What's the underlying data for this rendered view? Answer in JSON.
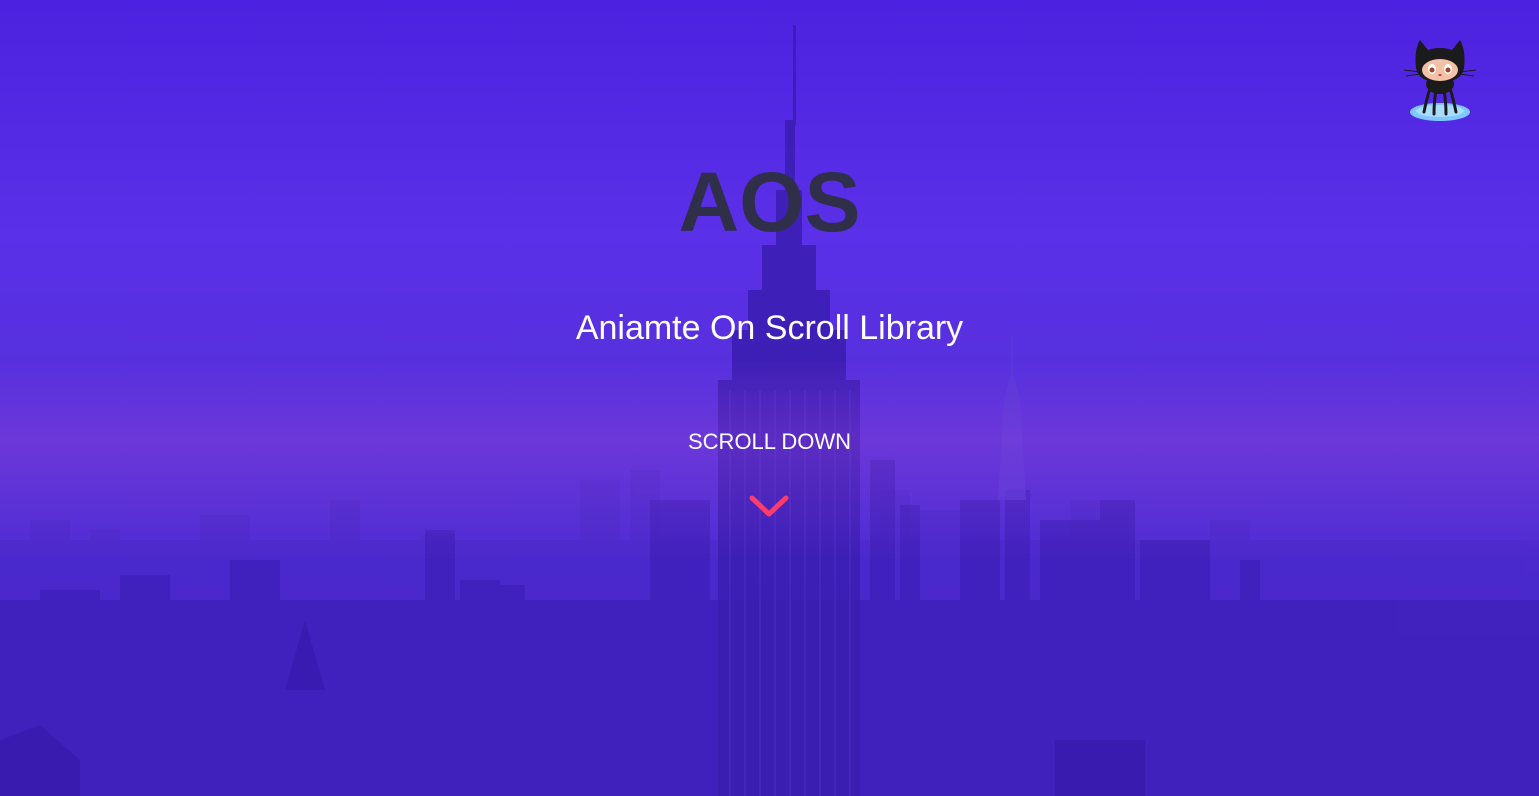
{
  "hero": {
    "title": "AOS",
    "subtitle": "Aniamte On Scroll Library",
    "scroll_label": "SCROLL DOWN"
  },
  "icons": {
    "github": "octocat-icon",
    "scroll": "chevron-down-icon"
  },
  "colors": {
    "background": "#5530d8",
    "title": "#2f2f4a",
    "text": "#ffffff",
    "chevron": "#ff3b6b"
  }
}
